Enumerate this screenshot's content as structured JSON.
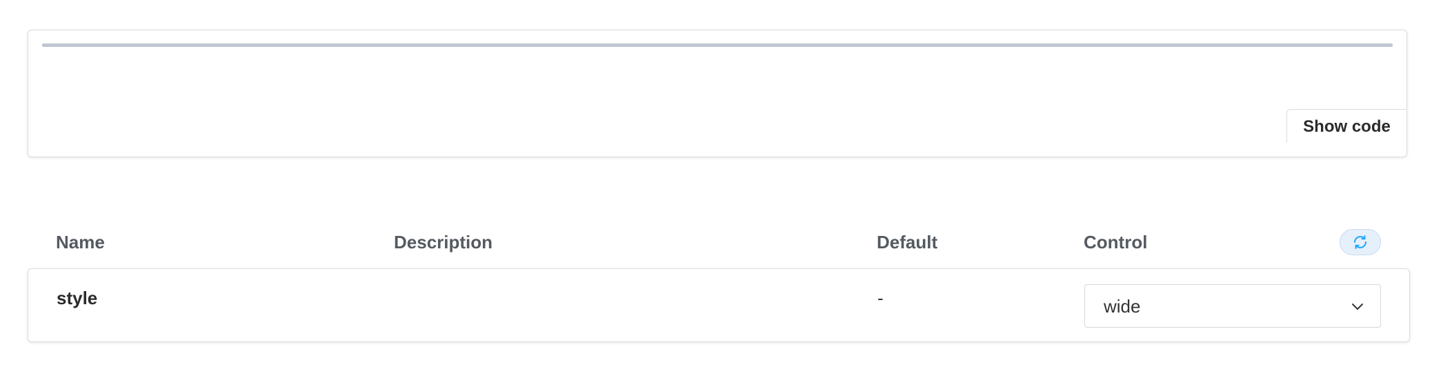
{
  "preview": {
    "show_code_label": "Show code"
  },
  "args_table": {
    "headers": {
      "name": "Name",
      "description": "Description",
      "default": "Default",
      "control": "Control"
    },
    "reset_icon": "sync-icon",
    "rows": [
      {
        "name": "style",
        "description": "",
        "default": "-",
        "control": {
          "type": "select",
          "selected": "wide"
        }
      }
    ]
  },
  "colors": {
    "divider": "#bfc7d3",
    "reset_button_bg": "#e6f0fb",
    "reset_icon": "#1ea7fd",
    "header_text": "#555a61"
  }
}
